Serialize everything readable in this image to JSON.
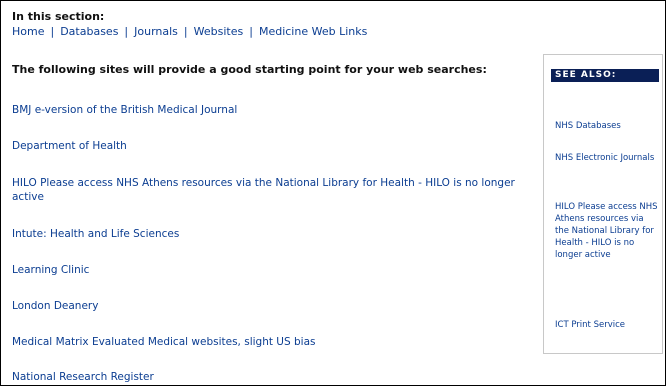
{
  "section": {
    "heading": "In this section:",
    "nav": [
      "Home",
      "Databases",
      "Journals",
      "Websites",
      "Medicine Web Links"
    ],
    "separator": "|"
  },
  "intro": "The following sites will provide a good starting point for your web searches:",
  "sites": [
    {
      "link": "BMJ e-version of the British Medical Journal",
      "desc": ""
    },
    {
      "link": "Department of Health",
      "desc": ""
    },
    {
      "link": "HILO Please access NHS Athens resources via the National Library for Health - HILO is no longer active",
      "desc": ""
    },
    {
      "link": "Intute: Health and Life Sciences",
      "desc": ""
    },
    {
      "link": "Learning Clinic",
      "desc": ""
    },
    {
      "link": "London Deanery",
      "desc": ""
    },
    {
      "link": "Medical Matrix",
      "desc": " Evaluated Medical websites, slight US bias"
    },
    {
      "link": "National Research Register",
      "desc": ""
    }
  ],
  "sidebar": {
    "heading": "SEE ALSO:",
    "items": [
      "NHS Databases",
      "NHS Electronic Journals",
      "HILO Please access NHS Athens resources via the National Library for Health - HILO is no longer active",
      "ICT Print Service"
    ]
  },
  "colors": {
    "link": "#0b3d91",
    "sidebar_header_bg": "#0a1f56"
  }
}
